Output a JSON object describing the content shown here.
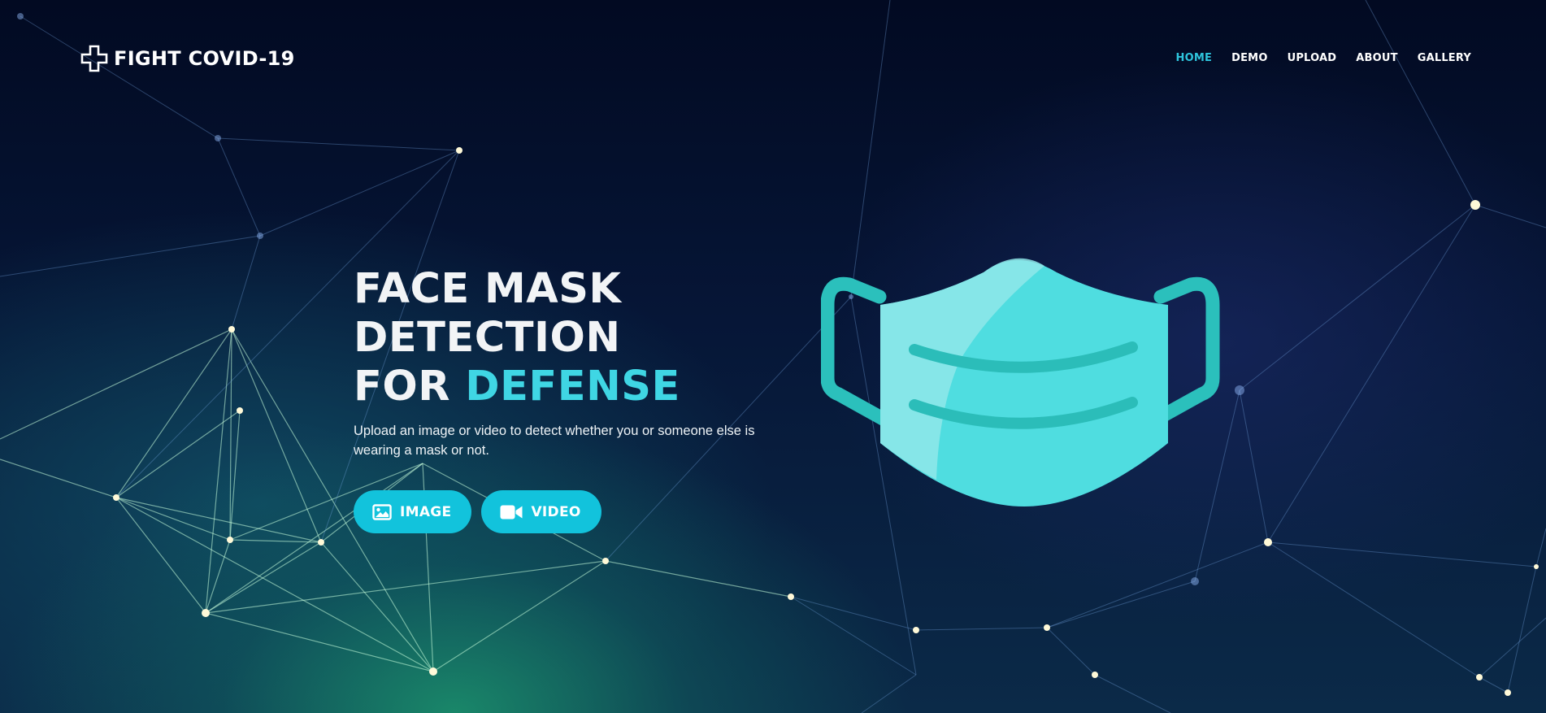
{
  "brand": {
    "name": "FIGHT COVID-19",
    "icon": "cross-icon"
  },
  "nav": {
    "items": [
      {
        "label": "HOME",
        "active": true
      },
      {
        "label": "DEMO",
        "active": false
      },
      {
        "label": "UPLOAD",
        "active": false
      },
      {
        "label": "ABOUT",
        "active": false
      },
      {
        "label": "GALLERY",
        "active": false
      }
    ]
  },
  "hero": {
    "title_line1": "FACE MASK",
    "title_line2": "DETECTION",
    "title_line3_prefix": "FOR ",
    "title_line3_accent": "DEFENSE",
    "description": "Upload an image or video to detect whether you or someone else is wearing a mask or not.",
    "buttons": {
      "image_label": "IMAGE",
      "image_icon": "image-icon",
      "video_label": "VIDEO",
      "video_icon": "video-camera-icon"
    }
  },
  "illustration": {
    "icon": "face-mask-icon"
  },
  "colors": {
    "accent": "#2ec4dc",
    "button": "#12c3dc",
    "mask_light": "#4fdde0",
    "mask_strap": "#2cc4c0",
    "background": "#04102a"
  }
}
